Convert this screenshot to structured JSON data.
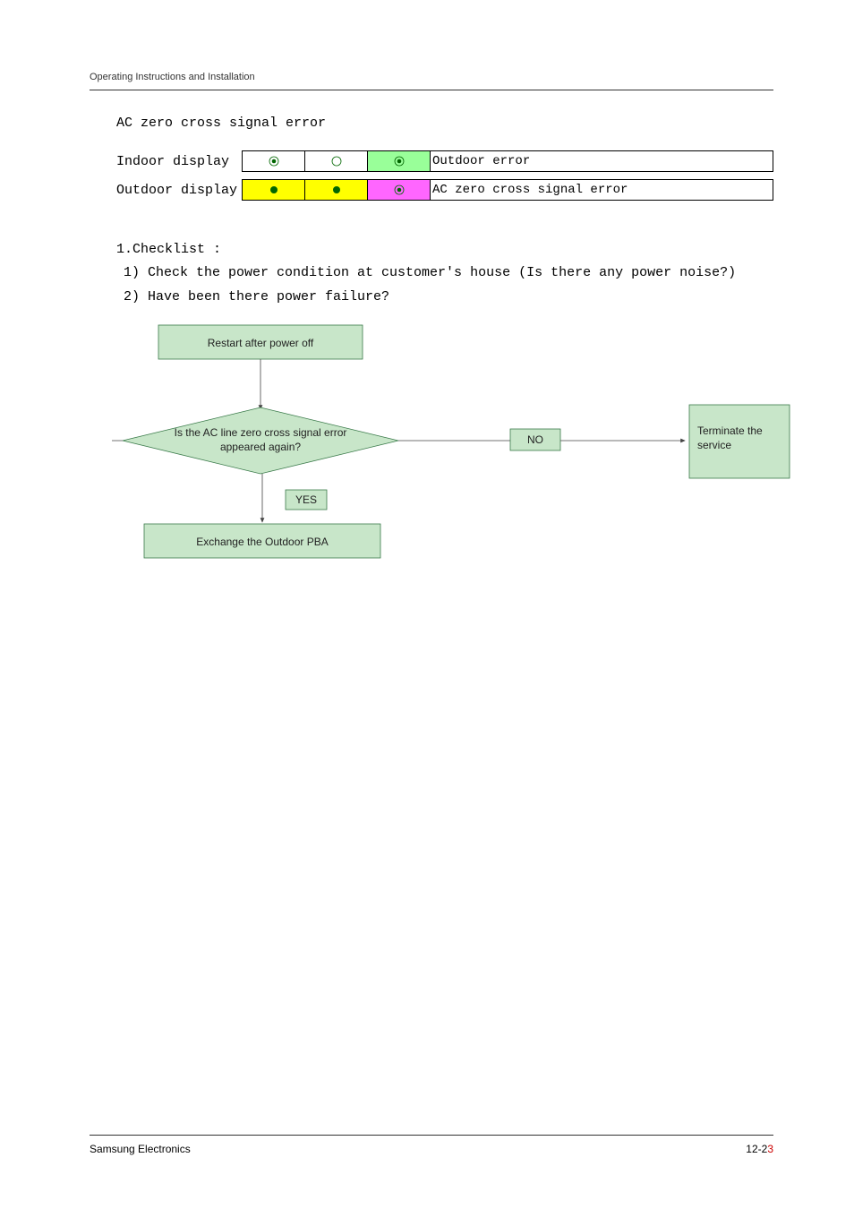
{
  "header": "Operating Instructions and Installation",
  "sectionTitle": "AC zero cross signal error",
  "display": {
    "indoor": {
      "label": "Indoor display",
      "desc": "Outdoor error"
    },
    "outdoor": {
      "label": "Outdoor display",
      "desc": "AC zero cross signal error"
    }
  },
  "checklist": {
    "title": "1.Checklist :",
    "item1": "1) Check the power condition at customer's house (Is there any power noise?)",
    "item2": "2) Have been there power failure?"
  },
  "flow": {
    "start": "Restart after power off",
    "decision": "Is the AC line zero cross signal error\nappeared again?",
    "noLabel": "NO",
    "yesLabel": "YES",
    "yesBox": "Exchange the  Outdoor PBA",
    "terminate": "Terminate the\nservice"
  },
  "footer": {
    "left": "Samsung Electronics",
    "right_a": "12-2",
    "right_b": "3"
  }
}
